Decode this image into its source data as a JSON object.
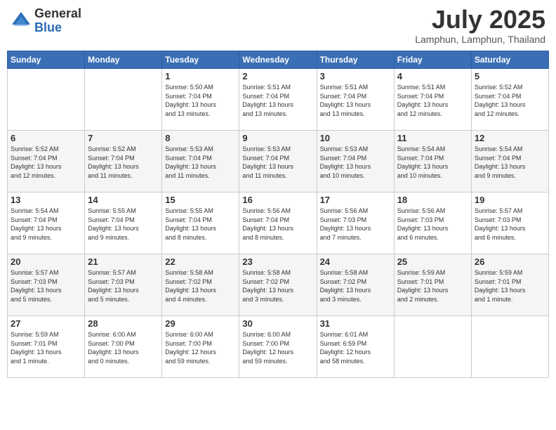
{
  "logo": {
    "general": "General",
    "blue": "Blue"
  },
  "title": "July 2025",
  "location": "Lamphun, Lamphun, Thailand",
  "days_of_week": [
    "Sunday",
    "Monday",
    "Tuesday",
    "Wednesday",
    "Thursday",
    "Friday",
    "Saturday"
  ],
  "weeks": [
    [
      {
        "day": "",
        "info": ""
      },
      {
        "day": "",
        "info": ""
      },
      {
        "day": "1",
        "info": "Sunrise: 5:50 AM\nSunset: 7:04 PM\nDaylight: 13 hours\nand 13 minutes."
      },
      {
        "day": "2",
        "info": "Sunrise: 5:51 AM\nSunset: 7:04 PM\nDaylight: 13 hours\nand 13 minutes."
      },
      {
        "day": "3",
        "info": "Sunrise: 5:51 AM\nSunset: 7:04 PM\nDaylight: 13 hours\nand 13 minutes."
      },
      {
        "day": "4",
        "info": "Sunrise: 5:51 AM\nSunset: 7:04 PM\nDaylight: 13 hours\nand 12 minutes."
      },
      {
        "day": "5",
        "info": "Sunrise: 5:52 AM\nSunset: 7:04 PM\nDaylight: 13 hours\nand 12 minutes."
      }
    ],
    [
      {
        "day": "6",
        "info": "Sunrise: 5:52 AM\nSunset: 7:04 PM\nDaylight: 13 hours\nand 12 minutes."
      },
      {
        "day": "7",
        "info": "Sunrise: 5:52 AM\nSunset: 7:04 PM\nDaylight: 13 hours\nand 11 minutes."
      },
      {
        "day": "8",
        "info": "Sunrise: 5:53 AM\nSunset: 7:04 PM\nDaylight: 13 hours\nand 11 minutes."
      },
      {
        "day": "9",
        "info": "Sunrise: 5:53 AM\nSunset: 7:04 PM\nDaylight: 13 hours\nand 11 minutes."
      },
      {
        "day": "10",
        "info": "Sunrise: 5:53 AM\nSunset: 7:04 PM\nDaylight: 13 hours\nand 10 minutes."
      },
      {
        "day": "11",
        "info": "Sunrise: 5:54 AM\nSunset: 7:04 PM\nDaylight: 13 hours\nand 10 minutes."
      },
      {
        "day": "12",
        "info": "Sunrise: 5:54 AM\nSunset: 7:04 PM\nDaylight: 13 hours\nand 9 minutes."
      }
    ],
    [
      {
        "day": "13",
        "info": "Sunrise: 5:54 AM\nSunset: 7:04 PM\nDaylight: 13 hours\nand 9 minutes."
      },
      {
        "day": "14",
        "info": "Sunrise: 5:55 AM\nSunset: 7:04 PM\nDaylight: 13 hours\nand 9 minutes."
      },
      {
        "day": "15",
        "info": "Sunrise: 5:55 AM\nSunset: 7:04 PM\nDaylight: 13 hours\nand 8 minutes."
      },
      {
        "day": "16",
        "info": "Sunrise: 5:56 AM\nSunset: 7:04 PM\nDaylight: 13 hours\nand 8 minutes."
      },
      {
        "day": "17",
        "info": "Sunrise: 5:56 AM\nSunset: 7:03 PM\nDaylight: 13 hours\nand 7 minutes."
      },
      {
        "day": "18",
        "info": "Sunrise: 5:56 AM\nSunset: 7:03 PM\nDaylight: 13 hours\nand 6 minutes."
      },
      {
        "day": "19",
        "info": "Sunrise: 5:57 AM\nSunset: 7:03 PM\nDaylight: 13 hours\nand 6 minutes."
      }
    ],
    [
      {
        "day": "20",
        "info": "Sunrise: 5:57 AM\nSunset: 7:03 PM\nDaylight: 13 hours\nand 5 minutes."
      },
      {
        "day": "21",
        "info": "Sunrise: 5:57 AM\nSunset: 7:03 PM\nDaylight: 13 hours\nand 5 minutes."
      },
      {
        "day": "22",
        "info": "Sunrise: 5:58 AM\nSunset: 7:02 PM\nDaylight: 13 hours\nand 4 minutes."
      },
      {
        "day": "23",
        "info": "Sunrise: 5:58 AM\nSunset: 7:02 PM\nDaylight: 13 hours\nand 3 minutes."
      },
      {
        "day": "24",
        "info": "Sunrise: 5:58 AM\nSunset: 7:02 PM\nDaylight: 13 hours\nand 3 minutes."
      },
      {
        "day": "25",
        "info": "Sunrise: 5:59 AM\nSunset: 7:01 PM\nDaylight: 13 hours\nand 2 minutes."
      },
      {
        "day": "26",
        "info": "Sunrise: 5:59 AM\nSunset: 7:01 PM\nDaylight: 13 hours\nand 1 minute."
      }
    ],
    [
      {
        "day": "27",
        "info": "Sunrise: 5:59 AM\nSunset: 7:01 PM\nDaylight: 13 hours\nand 1 minute."
      },
      {
        "day": "28",
        "info": "Sunrise: 6:00 AM\nSunset: 7:00 PM\nDaylight: 13 hours\nand 0 minutes."
      },
      {
        "day": "29",
        "info": "Sunrise: 6:00 AM\nSunset: 7:00 PM\nDaylight: 12 hours\nand 59 minutes."
      },
      {
        "day": "30",
        "info": "Sunrise: 6:00 AM\nSunset: 7:00 PM\nDaylight: 12 hours\nand 59 minutes."
      },
      {
        "day": "31",
        "info": "Sunrise: 6:01 AM\nSunset: 6:59 PM\nDaylight: 12 hours\nand 58 minutes."
      },
      {
        "day": "",
        "info": ""
      },
      {
        "day": "",
        "info": ""
      }
    ]
  ]
}
